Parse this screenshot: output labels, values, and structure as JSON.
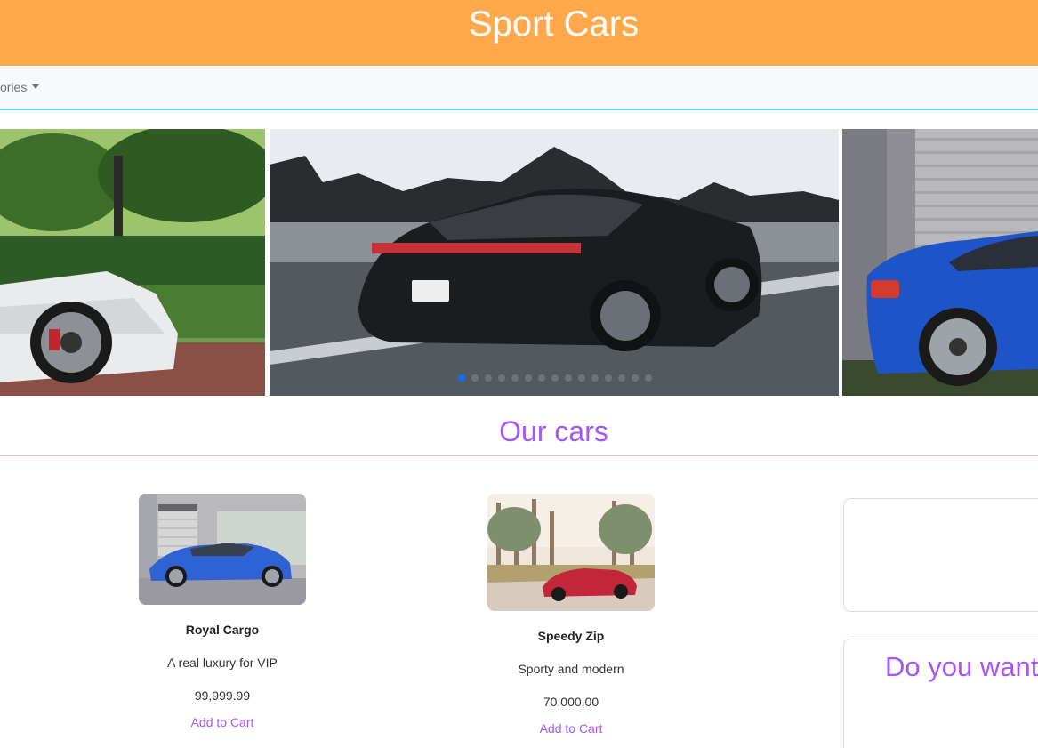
{
  "header": {
    "title": "Sport Cars",
    "background": "#ffa84c"
  },
  "navbar": {
    "dropdown_label": "ories",
    "border_color": "#5ad3f2"
  },
  "carousel": {
    "indicator_count": 15,
    "active_index": 0,
    "active_color": "#0d6efd"
  },
  "section": {
    "title": "Our cars",
    "accent": "#a855f7"
  },
  "products": [
    {
      "name": "Royal Cargo",
      "description": "A real luxury for VIP",
      "price": "99,999.99",
      "action": "Add to Cart"
    },
    {
      "name": "Speedy Zip",
      "description": "Sporty and modern",
      "price": "70,000.00",
      "action": "Add to Cart"
    }
  ],
  "promo": {
    "text": "Do you want"
  }
}
